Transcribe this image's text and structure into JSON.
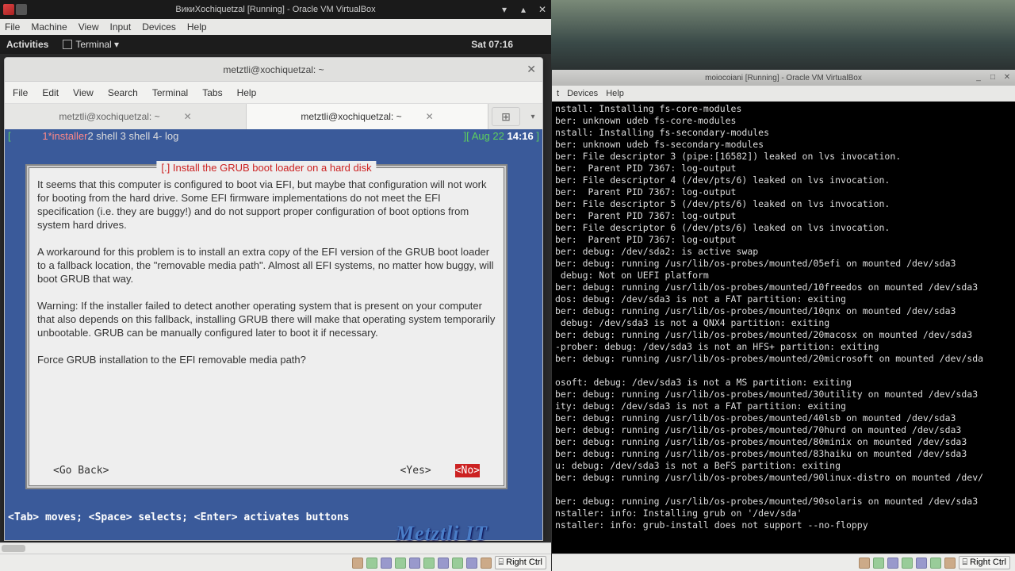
{
  "left": {
    "title": "ВикиXochiquetzal [Running] - Oracle VM VirtualBox",
    "vbox_menu": [
      "File",
      "Machine",
      "View",
      "Input",
      "Devices",
      "Help"
    ],
    "gnome": {
      "activities": "Activities",
      "terminal": "Terminal ▾",
      "clock": "Sat 07:16"
    },
    "term": {
      "title": "metztli@xochiquetzal: ~",
      "menu": [
        "File",
        "Edit",
        "View",
        "Search",
        "Terminal",
        "Tabs",
        "Help"
      ],
      "tabs": [
        "metztli@xochiquetzal: ~",
        "metztli@xochiquetzal: ~"
      ],
      "screen_sessions": "1*installer",
      "screen_rest": "  2 shell  3 shell  4- log",
      "screen_date": "Aug 22 ",
      "screen_time": "14:16",
      "dialog": {
        "title": "[.] Install the GRUB boot loader on a hard disk",
        "p1": "It seems that this computer is configured to boot via EFI, but maybe that configuration will not work for booting from the hard drive. Some EFI firmware implementations do not meet the EFI specification (i.e. they are buggy!) and do not support proper configuration of boot options from system hard drives.",
        "p2": "A workaround for this problem is to install an extra copy of the EFI version of the GRUB boot loader to a fallback location, the \"removable media path\". Almost all EFI systems, no matter how buggy, will boot GRUB that way.",
        "p3": "Warning: If the installer failed to detect another operating system that is present on your computer that also depends on this fallback, installing GRUB there will make that operating system temporarily unbootable. GRUB can be manually configured later to boot it if necessary.",
        "p4": "Force GRUB installation to the EFI removable media path?",
        "go_back": "<Go Back>",
        "yes": "<Yes>",
        "no": "<No>"
      },
      "hints": "<Tab> moves; <Space> selects; <Enter> activates buttons"
    },
    "watermark": "Metztli IT",
    "hostkey": "Right Ctrl"
  },
  "right": {
    "title": "moiocoiani [Running] - Oracle VM VirtualBox",
    "menu_partial": [
      "t",
      "Devices",
      "Help"
    ],
    "log": "nstall: Installing fs-core-modules\nber: unknown udeb fs-core-modules\nnstall: Installing fs-secondary-modules\nber: unknown udeb fs-secondary-modules\nber: File descriptor 3 (pipe:[16582]) leaked on lvs invocation.\nber:  Parent PID 7367: log-output\nber: File descriptor 4 (/dev/pts/6) leaked on lvs invocation.\nber:  Parent PID 7367: log-output\nber: File descriptor 5 (/dev/pts/6) leaked on lvs invocation.\nber:  Parent PID 7367: log-output\nber: File descriptor 6 (/dev/pts/6) leaked on lvs invocation.\nber:  Parent PID 7367: log-output\nber: debug: /dev/sda2: is active swap\nber: debug: running /usr/lib/os-probes/mounted/05efi on mounted /dev/sda3\n debug: Not on UEFI platform\nber: debug: running /usr/lib/os-probes/mounted/10freedos on mounted /dev/sda3\ndos: debug: /dev/sda3 is not a FAT partition: exiting\nber: debug: running /usr/lib/os-probes/mounted/10qnx on mounted /dev/sda3\n debug: /dev/sda3 is not a QNX4 partition: exiting\nber: debug: running /usr/lib/os-probes/mounted/20macosx on mounted /dev/sda3\n-prober: debug: /dev/sda3 is not an HFS+ partition: exiting\nber: debug: running /usr/lib/os-probes/mounted/20microsoft on mounted /dev/sda\n\nosoft: debug: /dev/sda3 is not a MS partition: exiting\nber: debug: running /usr/lib/os-probes/mounted/30utility on mounted /dev/sda3\nity: debug: /dev/sda3 is not a FAT partition: exiting\nber: debug: running /usr/lib/os-probes/mounted/40lsb on mounted /dev/sda3\nber: debug: running /usr/lib/os-probes/mounted/70hurd on mounted /dev/sda3\nber: debug: running /usr/lib/os-probes/mounted/80minix on mounted /dev/sda3\nber: debug: running /usr/lib/os-probes/mounted/83haiku on mounted /dev/sda3\nu: debug: /dev/sda3 is not a BeFS partition: exiting\nber: debug: running /usr/lib/os-probes/mounted/90linux-distro on mounted /dev/\n\nber: debug: running /usr/lib/os-probes/mounted/90solaris on mounted /dev/sda3\nnstaller: info: Installing grub on '/dev/sda'\nnstaller: info: grub-install does not support --no-floppy",
    "hostkey": "Right Ctrl"
  }
}
